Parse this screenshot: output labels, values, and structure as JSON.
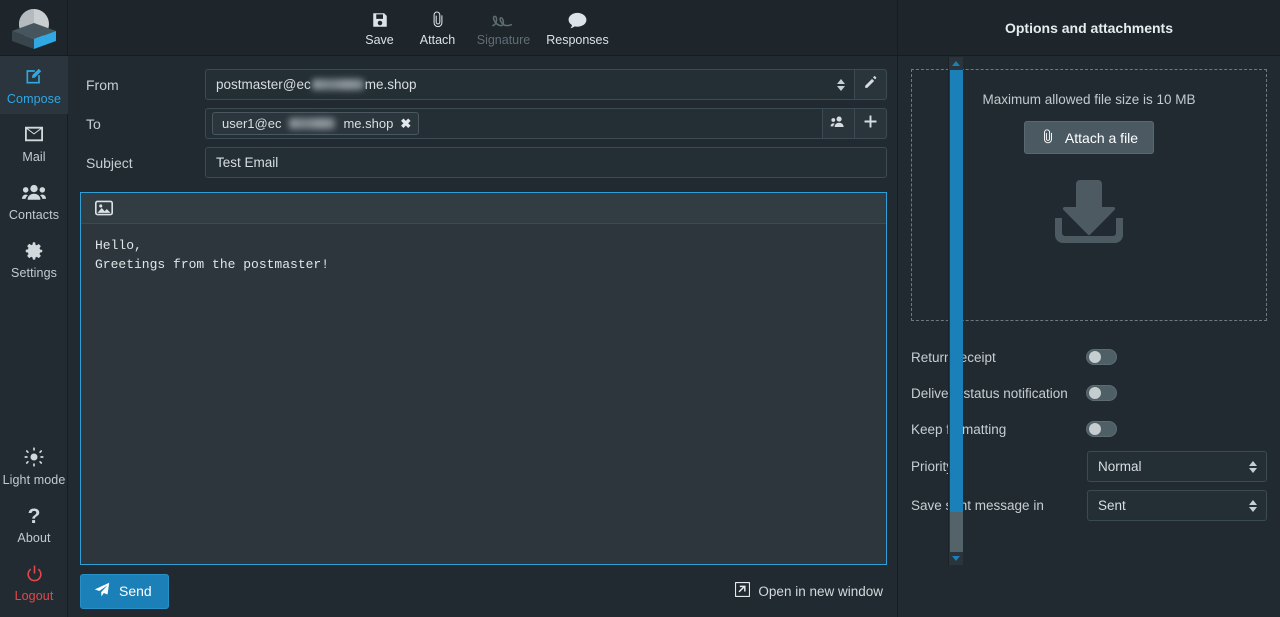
{
  "app": {
    "logo_name": "snappymail-logo",
    "theme": "dark"
  },
  "sidebar": {
    "items": [
      {
        "id": "compose",
        "label": "Compose",
        "icon": "compose-pencil-icon",
        "active": true
      },
      {
        "id": "mail",
        "label": "Mail",
        "icon": "envelope-icon",
        "active": false
      },
      {
        "id": "contacts",
        "label": "Contacts",
        "icon": "people-icon",
        "active": false
      },
      {
        "id": "settings",
        "label": "Settings",
        "icon": "gear-icon",
        "active": false
      }
    ],
    "footer_items": [
      {
        "id": "light-mode",
        "label": "Light mode",
        "icon": "sun-icon"
      },
      {
        "id": "about",
        "label": "About",
        "icon": "question-mark-icon"
      },
      {
        "id": "logout",
        "label": "Logout",
        "icon": "power-icon",
        "color": "#e8474a"
      }
    ]
  },
  "toolbar": {
    "save_label": "Save",
    "attach_label": "Attach",
    "signature_label": "Signature",
    "responses_label": "Responses",
    "signature_disabled": true
  },
  "compose": {
    "from_label": "From",
    "to_label": "To",
    "subject_label": "Subject",
    "from_value_prefix": "postmaster@ec",
    "from_value_suffix": "me.shop",
    "to_chip_prefix": "user1@ec",
    "to_chip_suffix": "me.shop",
    "to_chip_remove": "✖",
    "subject_value": "Test Email",
    "body": "Hello,\nGreetings from the postmaster!",
    "editor_image_icon": "insert-image-icon",
    "identity_edit_icon": "pencil-icon",
    "contacts_icon": "people-icon",
    "add_recipient_icon": "plus-icon"
  },
  "bottom": {
    "send_label": "Send",
    "send_icon": "paper-plane-icon",
    "open_new_window_label": "Open in new window",
    "open_new_window_icon": "external-link-icon"
  },
  "options": {
    "title": "Options and attachments",
    "dropzone": {
      "max_size_text": "Maximum allowed file size is 10 MB",
      "attach_button_label": "Attach a file",
      "attach_icon": "paperclip-icon",
      "drop_icon": "download-tray-icon"
    },
    "toggles": [
      {
        "id": "return-receipt",
        "label": "Return receipt",
        "on": false
      },
      {
        "id": "delivery-status",
        "label": "Delivery status notification",
        "on": false
      },
      {
        "id": "keep-formatting",
        "label": "Keep formatting",
        "on": false
      }
    ],
    "selects": [
      {
        "id": "priority",
        "label": "Priority",
        "value": "Normal"
      },
      {
        "id": "save-sent",
        "label": "Save sent message in",
        "value": "Sent"
      }
    ]
  },
  "colors": {
    "accent": "#2fa8e4",
    "send_button": "#1b7fb8",
    "logout": "#e8474a",
    "panel_bg": "#212a30",
    "bar_bg": "#1e262b",
    "editor_bg": "#2c363c"
  }
}
